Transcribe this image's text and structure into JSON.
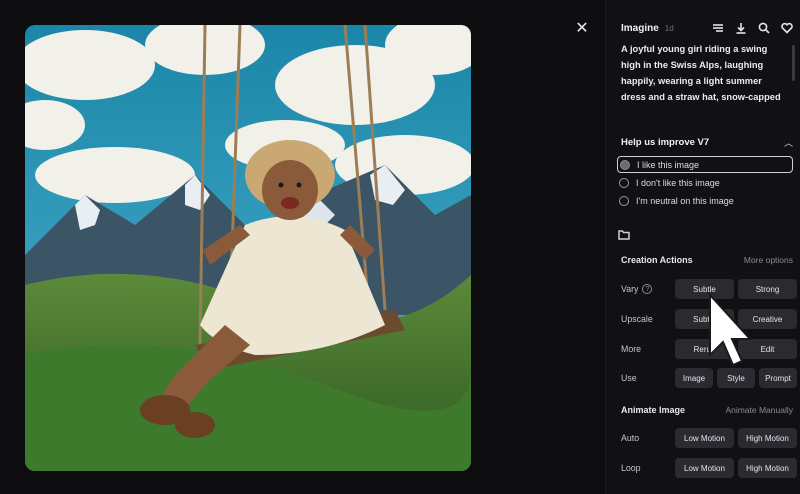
{
  "panel": {
    "title": "Imagine",
    "age": "1d",
    "prompt": "A joyful young girl riding a swing high in the Swiss Alps, laughing happily, wearing a light summer dress and a straw hat, snow-capped mountains and lush green meadows in the"
  },
  "improve": {
    "title": "Help us improve V7",
    "options": [
      "I like this image",
      "I don't like this image",
      "I'm neutral on this image"
    ],
    "selected": 0
  },
  "creation": {
    "title": "Creation Actions",
    "more_link": "More options",
    "vary": {
      "label": "Vary",
      "help": "?",
      "buttons": [
        "Subtle",
        "Strong"
      ]
    },
    "upscale": {
      "label": "Upscale",
      "buttons": [
        "Subtle",
        "Creative"
      ]
    },
    "more": {
      "label": "More",
      "buttons": [
        "Rerun",
        "Edit"
      ]
    },
    "use": {
      "label": "Use",
      "buttons": [
        "Image",
        "Style",
        "Prompt"
      ]
    }
  },
  "animate": {
    "title": "Animate Image",
    "link": "Animate Manually",
    "auto": {
      "label": "Auto",
      "buttons": [
        "Low Motion",
        "High Motion"
      ]
    },
    "loop": {
      "label": "Loop",
      "buttons": [
        "Low Motion",
        "High Motion"
      ]
    }
  },
  "icons": {
    "close": "close-icon",
    "menu": "menu-icon",
    "download": "download-icon",
    "search": "search-icon",
    "favorite": "heart-icon",
    "folder": "folder-icon",
    "collapse": "chevron-up-icon"
  },
  "colors": {
    "background": "#0d0d10",
    "panel": "#111114",
    "button": "#2a2a30"
  }
}
